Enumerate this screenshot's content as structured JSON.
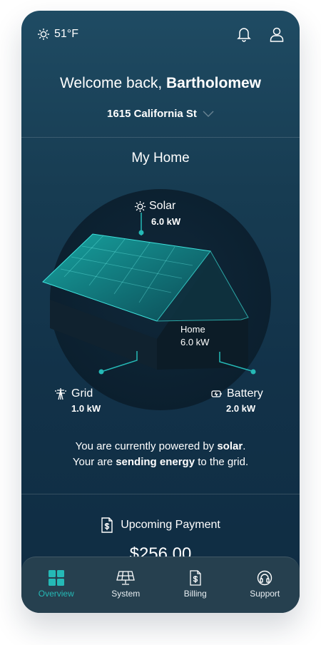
{
  "header": {
    "temperature": "51°F"
  },
  "welcome": {
    "prefix": "Welcome back,",
    "name": "Bartholomew"
  },
  "address": "1615 California St",
  "section_title": "My Home",
  "energy": {
    "solar": {
      "name": "Solar",
      "value": "6.0 kW"
    },
    "home": {
      "name": "Home",
      "value": "6.0 kW"
    },
    "grid": {
      "name": "Grid",
      "value": "1.0 kW"
    },
    "battery": {
      "name": "Battery",
      "value": "2.0 kW"
    }
  },
  "status": {
    "line1_prefix": "You are currently powered by ",
    "line1_bold": "solar",
    "line1_suffix": ".",
    "line2_prefix": "Your are ",
    "line2_bold": "sending energy",
    "line2_suffix": " to the grid."
  },
  "payment": {
    "label": "Upcoming Payment",
    "amount": "$256.00"
  },
  "tabs": [
    {
      "label": "Overview"
    },
    {
      "label": "System"
    },
    {
      "label": "Billing"
    },
    {
      "label": "Support"
    }
  ],
  "colors": {
    "accent": "#25b9b6",
    "background": "#173c52"
  }
}
